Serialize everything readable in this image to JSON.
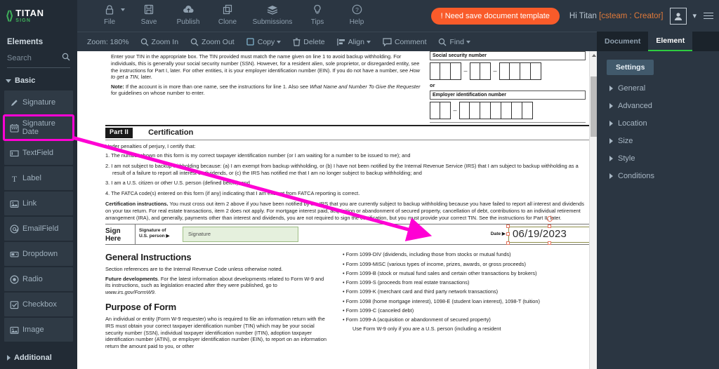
{
  "app": {
    "logo_name": "TITAN",
    "logo_sub": "SIGN"
  },
  "toolbar": {
    "items": [
      {
        "label": "File",
        "icon": "lock-icon",
        "caret": true
      },
      {
        "label": "Save",
        "icon": "save-icon",
        "caret": false
      },
      {
        "label": "Publish",
        "icon": "cloud-upload-icon",
        "caret": false
      },
      {
        "label": "Clone",
        "icon": "copy-icon",
        "caret": false
      },
      {
        "label": "Submissions",
        "icon": "layers-icon",
        "caret": false
      },
      {
        "label": "Tips",
        "icon": "lightbulb-icon",
        "caret": false
      },
      {
        "label": "Help",
        "icon": "question-circle-icon",
        "caret": false
      }
    ],
    "need_save_label": "! Need save document template",
    "greeting_prefix": "Hi Titan ",
    "greeting_role": "[csteam : Creator]"
  },
  "subbar": {
    "zoom_label": "Zoom: 180%",
    "items": [
      {
        "label": "Zoom In",
        "icon": "magnifier-plus-icon",
        "caret": false
      },
      {
        "label": "Zoom Out",
        "icon": "magnifier-minus-icon",
        "caret": false
      },
      {
        "label": "Copy",
        "icon": "copy-icon",
        "caret": true
      },
      {
        "label": "Delete",
        "icon": "trash-icon",
        "caret": false
      },
      {
        "label": "Align",
        "icon": "align-icon",
        "caret": true
      },
      {
        "label": "Comment",
        "icon": "comment-icon",
        "caret": false
      },
      {
        "label": "Find",
        "icon": "magnifier-icon",
        "caret": true
      }
    ]
  },
  "sidebar": {
    "title": "Elements",
    "search_placeholder": "Search",
    "search_value": "",
    "group_basic": "Basic",
    "group_additional": "Additional",
    "items": [
      {
        "label": "Signature",
        "icon": "pen-icon",
        "selected": false
      },
      {
        "label": "Signature Date",
        "icon": "calendar-icon",
        "selected": true
      },
      {
        "label": "TextField",
        "icon": "textfield-icon",
        "selected": false
      },
      {
        "label": "Label",
        "icon": "label-t-icon",
        "selected": false
      },
      {
        "label": "Link",
        "icon": "image-link-icon",
        "selected": false
      },
      {
        "label": "EmailField",
        "icon": "at-icon",
        "selected": false
      },
      {
        "label": "Dropdown",
        "icon": "dropdown-icon",
        "selected": false
      },
      {
        "label": "Radio",
        "icon": "radio-icon",
        "selected": false
      },
      {
        "label": "Checkbox",
        "icon": "checkbox-icon",
        "selected": false
      },
      {
        "label": "Image",
        "icon": "image-icon",
        "selected": false
      }
    ]
  },
  "rightbar": {
    "tabs": [
      {
        "label": "Document",
        "active": false
      },
      {
        "label": "Element",
        "active": true
      }
    ],
    "settings_label": "Settings",
    "sections": [
      {
        "label": "General"
      },
      {
        "label": "Advanced"
      },
      {
        "label": "Location"
      },
      {
        "label": "Size"
      },
      {
        "label": "Style"
      },
      {
        "label": "Conditions"
      }
    ]
  },
  "colors": {
    "accent_orange": "#f95b2a",
    "brand_green": "#3fae5a",
    "annotation_magenta": "#ff00d4",
    "selection_handle": "#e2725b",
    "signature_field_bg": "#e5f0dd"
  },
  "document": {
    "tin_paragraph": "Enter your TIN in the appropriate box. The TIN provided must match the name given on line 1 to avoid backup withholding. For individuals, this is generally your social security number (SSN). However, for a resident alien, sole proprietor, or disregarded entity, see the instructions for Part I, later. For other entities, it is your employer identification number (EIN). If you do not have a number, see ",
    "tin_paragraph_ital": "How to get a TIN",
    "tin_paragraph_end": ", later.",
    "note_label": "Note:",
    "note_text": " If the account is in more than one name, see the instructions for line 1. Also see ",
    "note_ital": "What Name and Number To Give the Requester",
    "note_end": " for guidelines on whose number to enter.",
    "ssn_label": "Social security number",
    "or_label": "or",
    "ein_label": "Employer identification number",
    "part_badge": "Part II",
    "part_title": "Certification",
    "penalties_line": "Under penalties of perjury, I certify that:",
    "cert_items": [
      "1. The number shown on this form is my correct taxpayer identification number (or I am waiting for a number to be issued to me); and",
      "2. I am not subject to backup withholding because: (a) I am exempt from backup withholding, or (b) I have not been notified by the Internal Revenue Service (IRS) that I am subject to backup withholding as a result of a failure to report all interest or dividends, or (c) the IRS has notified me that I am no longer subject to backup withholding; and",
      "3. I am a U.S. citizen or other U.S. person (defined below); and",
      "4. The FATCA code(s) entered on this form (if any) indicating that I am exempt from FATCA reporting is correct."
    ],
    "cert_instructions_label": "Certification instructions.",
    "cert_instructions_text": " You must cross out item 2 above if you have been notified by the IRS that you are currently subject to backup withholding because you have failed to report all interest and dividends on your tax return. For real estate transactions, item 2 does not apply. For mortgage interest paid, acquisition or abandonment of secured property, cancellation of debt, contributions to an individual retirement arrangement (IRA), and generally, payments other than interest and dividends, you are not required to sign the certification, but you must provide your correct TIN. See the instructions for Part II, later.",
    "sign_here_line1": "Sign",
    "sign_here_line2": "Here",
    "signature_of_line1": "Signature of",
    "signature_of_line2": "U.S. person ▶",
    "signature_placeholder": "Signature",
    "date_label": "Date ▶",
    "date_value": "06/19/2023",
    "general_instructions_title": "General Instructions",
    "general_instructions_p1": "Section references are to the Internal Revenue Code unless otherwise noted.",
    "future_dev_label": "Future developments",
    "future_dev_text": ". For the latest information about developments related to Form W-9 and its instructions, such as legislation enacted after they were published, go to ",
    "future_dev_url": "www.irs.gov/FormW9",
    "future_dev_end": ".",
    "purpose_title": "Purpose of Form",
    "purpose_text": "An individual or entity (Form W-9 requester) who is required to file an information return with the IRS must obtain your correct taxpayer identification number (TIN) which may be your social security number (SSN), individual taxpayer identification number (ITIN), adoption taxpayer identification number (ATIN), or employer identification number (EIN), to report on an information return the amount paid to you, or other",
    "form_bullets": [
      "• Form 1099-DIV (dividends, including those from stocks or mutual funds)",
      "• Form 1099-MISC (various types of income, prizes, awards, or gross proceeds)",
      "• Form 1099-B (stock or mutual fund sales and certain other transactions by brokers)",
      "• Form 1099-S (proceeds from real estate transactions)",
      "• Form 1099-K (merchant card and third party network transactions)",
      "• Form 1098 (home mortgage interest), 1098-E (student loan interest), 1098-T (tuition)",
      "• Form 1099-C (canceled debt)",
      "• Form 1099-A (acquisition or abandonment of secured property)"
    ],
    "form_bullets_tail": "Use Form W-9 only if you are a U.S. person (including a resident"
  }
}
